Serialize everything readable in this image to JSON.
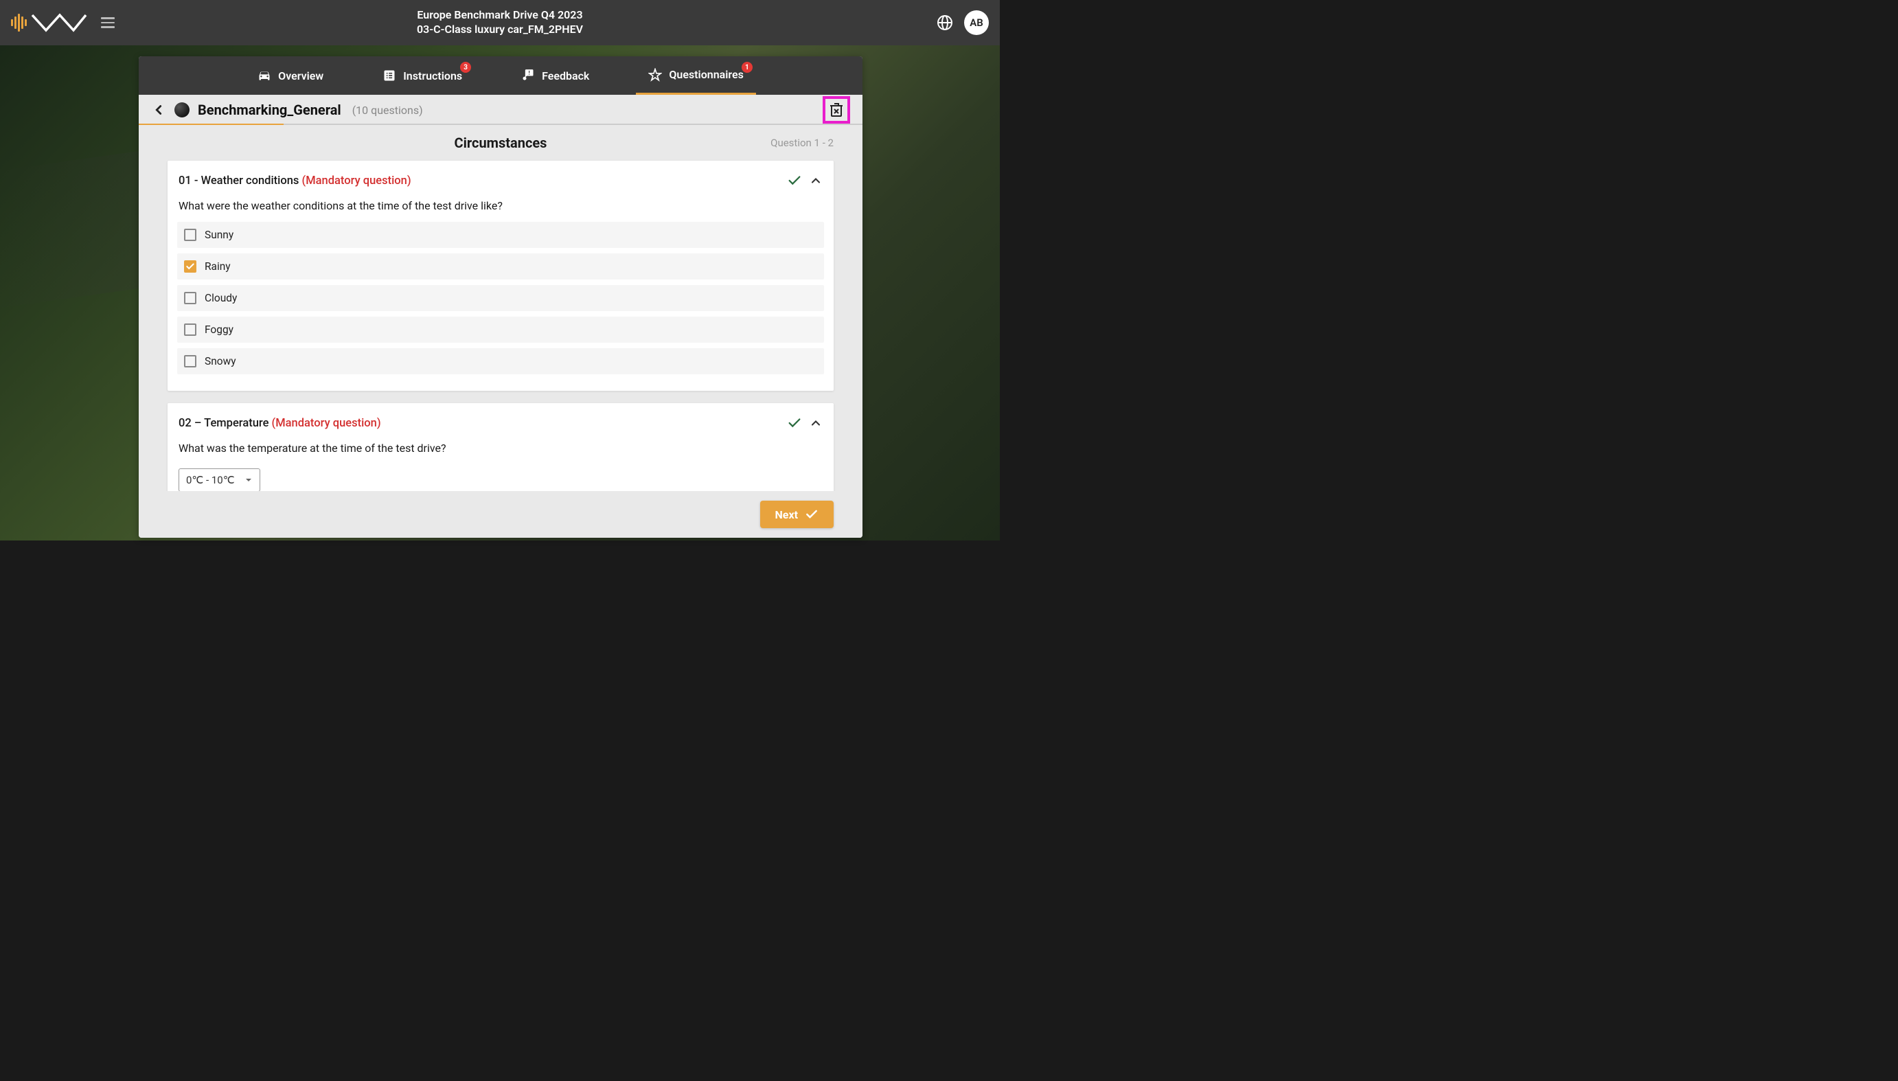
{
  "header": {
    "title_line1": "Europe Benchmark Drive Q4 2023",
    "title_line2": "03-C-Class luxury car_FM_2PHEV",
    "avatar_initials": "AB"
  },
  "tabs": {
    "overview": "Overview",
    "instructions": {
      "label": "Instructions",
      "badge": "3"
    },
    "feedback": "Feedback",
    "questionnaires": {
      "label": "Questionnaires",
      "badge": "1"
    }
  },
  "subheader": {
    "name": "Benchmarking_General",
    "count": "(10 questions)"
  },
  "section": {
    "title": "Circumstances",
    "range": "Question 1 - 2"
  },
  "q1": {
    "number_title": "01 - Weather conditions",
    "mandatory": " (Mandatory question)",
    "text": "What were the weather conditions at the time of the test drive like?",
    "options": [
      "Sunny",
      "Rainy",
      "Cloudy",
      "Foggy",
      "Snowy"
    ],
    "selected_index": 1
  },
  "q2": {
    "number_title": "02 – Temperature",
    "mandatory": " (Mandatory question)",
    "text": "What was the temperature at the time of the test drive?",
    "selected": "0℃ - 10℃"
  },
  "footer": {
    "next": "Next"
  }
}
